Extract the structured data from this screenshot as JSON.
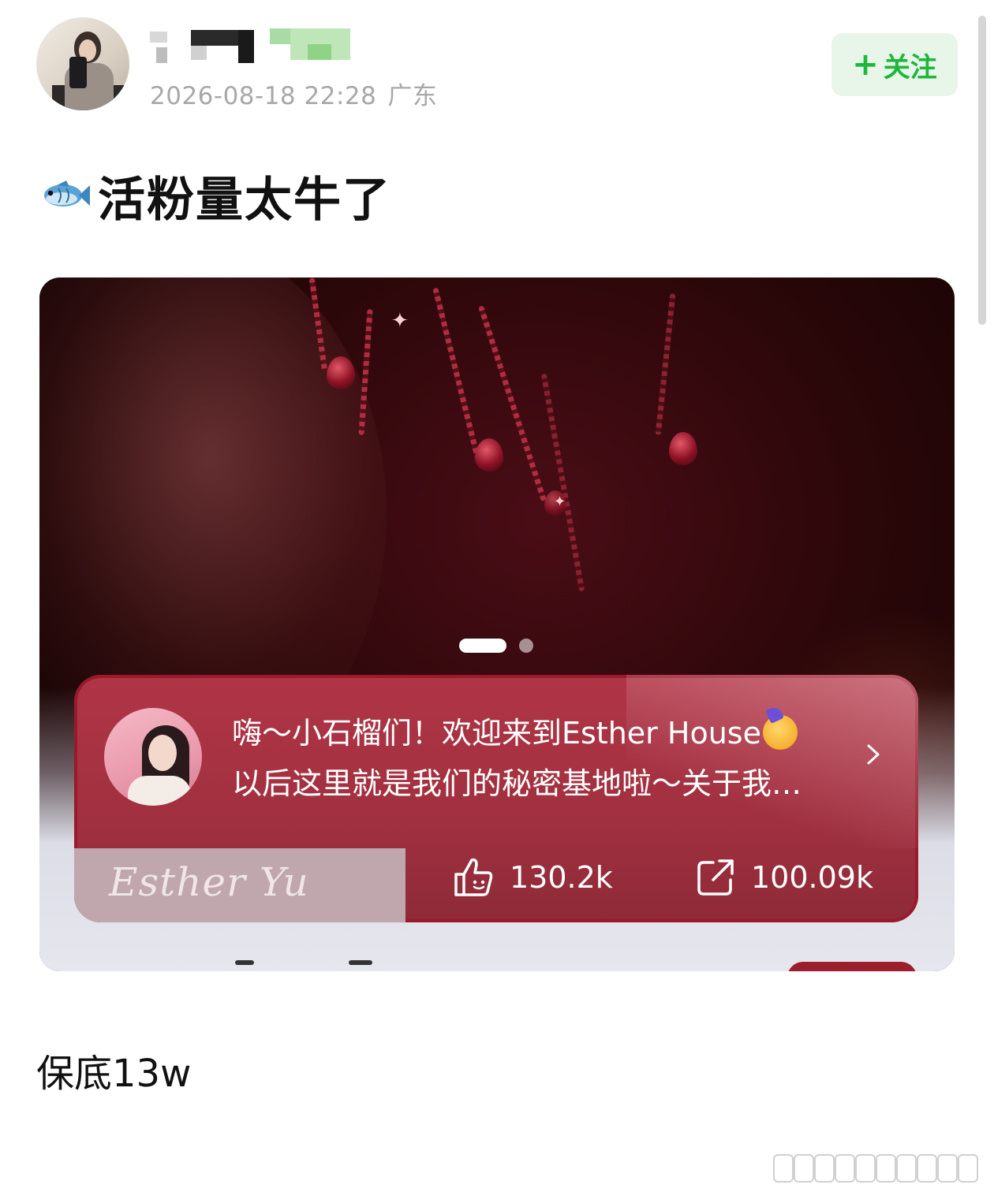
{
  "post": {
    "timestamp": "2026-08-18 22:28",
    "location": "广东",
    "follow_label": "+关注",
    "follow_plus": "+",
    "follow_text": "关注",
    "title": "活粉量太牛了",
    "caption": "保底13w"
  },
  "media": {
    "page_count": 2,
    "active_page": 1,
    "card": {
      "line1": "嗨～小石榴们！欢迎来到Esther House",
      "line2": "以后这里就是我们的秘密基地啦～关于我…",
      "signature": "Esther Yu",
      "likes": "130.2k",
      "shares": "100.09k"
    }
  },
  "icons": {
    "title_emoji": "fish-icon",
    "card_emoji": "partying-face-icon",
    "like": "thumbs-up-icon",
    "share": "share-icon",
    "chevron": "chevron-right-icon"
  },
  "colors": {
    "follow_text": "#1fb63c",
    "follow_bg": "#e8f6ea",
    "card_bg": "#a0303f",
    "meta_text": "#a8a8a8"
  }
}
